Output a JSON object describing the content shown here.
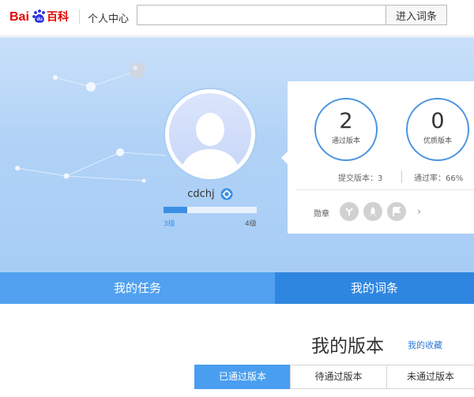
{
  "header": {
    "logo_alt": "Baidu百科",
    "center_link": "个人中心",
    "search_placeholder": "",
    "search_button": "进入词条"
  },
  "profile": {
    "username": "cdchj",
    "level_current": "3级",
    "level_next": "4级",
    "level_progress": 0.25
  },
  "stats": {
    "passed_versions": "2",
    "passed_versions_label": "通过版本",
    "quality_versions": "0",
    "quality_versions_label": "优质版本",
    "submitted": "提交版本：3",
    "pass_rate": "通过率：66%",
    "badges_label": "勋章"
  },
  "tabs": {
    "tasks": "我的任务",
    "entries": "我的词条"
  },
  "versions": {
    "title": "我的版本",
    "favorites_link": "我的收藏",
    "tabs": [
      "已通过版本",
      "待通过版本",
      "未通过版本"
    ]
  },
  "colors": {
    "accent": "#2f86e0",
    "tab_light": "#51a1f0",
    "brand_red": "#e10601",
    "brand_blue": "#2932e1"
  }
}
